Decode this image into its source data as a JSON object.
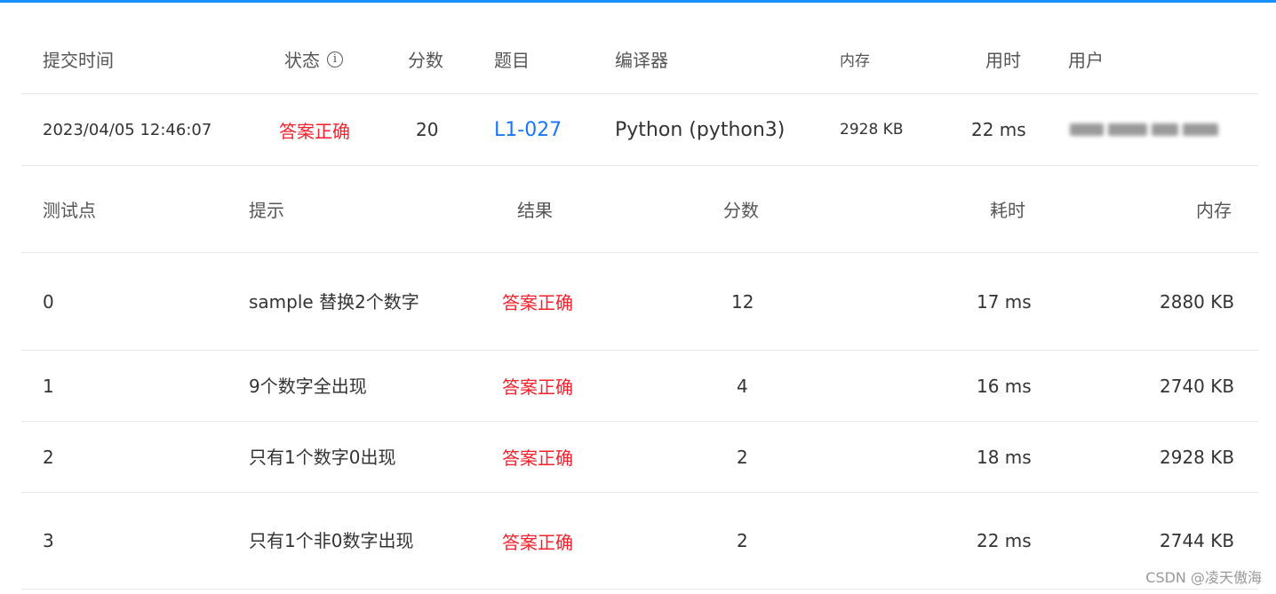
{
  "submission": {
    "headers": {
      "time": "提交时间",
      "status": "状态",
      "score": "分数",
      "problem": "题目",
      "compiler": "编译器",
      "memory": "内存",
      "duration": "用时",
      "user": "用户"
    },
    "row": {
      "time": "2023/04/05 12:46:07",
      "status": "答案正确",
      "score": "20",
      "problem": "L1-027",
      "compiler": "Python (python3)",
      "memory": "2928 KB",
      "duration": "22 ms",
      "user_blurred": true
    },
    "status_info_icon": "info-circle-icon"
  },
  "testpoints": {
    "headers": {
      "point": "测试点",
      "hint": "提示",
      "result": "结果",
      "score": "分数",
      "duration": "耗时",
      "memory": "内存"
    },
    "rows": [
      {
        "point": "0",
        "hint": "sample 替换2个数字",
        "result": "答案正确",
        "score": "12",
        "duration": "17 ms",
        "memory": "2880 KB"
      },
      {
        "point": "1",
        "hint": "9个数字全出现",
        "result": "答案正确",
        "score": "4",
        "duration": "16 ms",
        "memory": "2740 KB"
      },
      {
        "point": "2",
        "hint": "只有1个数字0出现",
        "result": "答案正确",
        "score": "2",
        "duration": "18 ms",
        "memory": "2928 KB"
      },
      {
        "point": "3",
        "hint": "只有1个非0数字出现",
        "result": "答案正确",
        "score": "2",
        "duration": "22 ms",
        "memory": "2744 KB"
      }
    ]
  },
  "colors": {
    "accent": "#1890ff",
    "success_text": "#f5222d",
    "link": "#1677ff"
  },
  "watermark": "CSDN @凌天傲海"
}
